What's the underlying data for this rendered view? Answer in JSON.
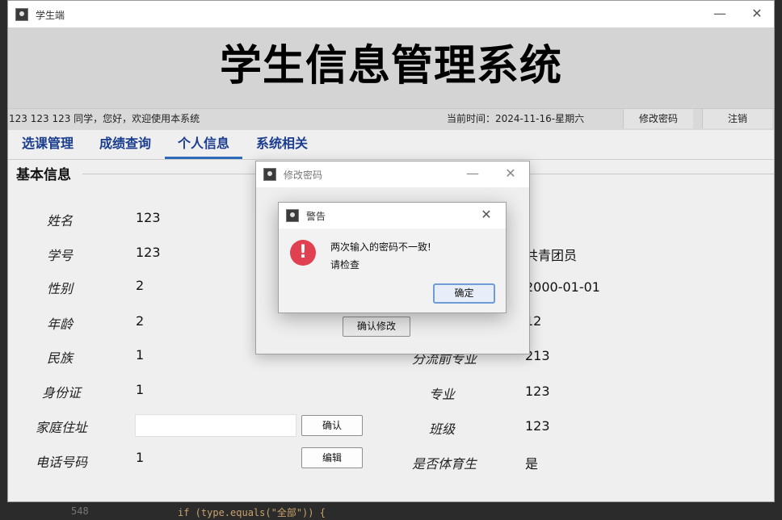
{
  "window": {
    "title": "学生端",
    "minimize_glyph": "—",
    "close_glyph": "✕"
  },
  "banner": {
    "title": "学生信息管理系统"
  },
  "status": {
    "greeting": "123 123 123 同学，您好，欢迎使用本系统",
    "time": "当前时间：2024-11-16-星期六",
    "change_password": "修改密码",
    "logout": "注销"
  },
  "tabs": [
    {
      "label": "选课管理"
    },
    {
      "label": "成绩查询"
    },
    {
      "label": "个人信息"
    },
    {
      "label": "系统相关"
    }
  ],
  "section": {
    "title": "基本信息"
  },
  "left_fields": [
    {
      "label": "姓名",
      "value": "123"
    },
    {
      "label": "学号",
      "value": "123"
    },
    {
      "label": "性别",
      "value": "2"
    },
    {
      "label": "年龄",
      "value": "2"
    },
    {
      "label": "民族",
      "value": "1"
    },
    {
      "label": "身份证",
      "value": "1"
    },
    {
      "label": "家庭住址",
      "value": ""
    },
    {
      "label": "电话号码",
      "value": "1"
    }
  ],
  "right_fields": [
    {
      "label": "",
      "value": "共青团员"
    },
    {
      "label": "",
      "value": "2000-01-01"
    },
    {
      "label": "",
      "value": "12"
    },
    {
      "label": "分流前专业",
      "value": "213"
    },
    {
      "label": "专业",
      "value": "123"
    },
    {
      "label": "班级",
      "value": "123"
    },
    {
      "label": "是否体育生",
      "value": "是"
    }
  ],
  "buttons": {
    "confirm": "确认",
    "edit": "编辑"
  },
  "dialog_change_password": {
    "title": "修改密码",
    "confirm_button": "确认修改",
    "minimize_glyph": "—",
    "close_glyph": "✕"
  },
  "dialog_warning": {
    "title": "警告",
    "line1": "两次输入的密码不一致!",
    "line2": "请检查",
    "ok_button": "确定",
    "icon_glyph": "!",
    "close_glyph": "✕"
  },
  "background_code": {
    "line_no": "548",
    "text": "if (type.equals(\"全部\")) {"
  },
  "colors": {
    "tab_text": "#1a3d8f",
    "tab_underline": "#2d6bb8",
    "error_icon": "#e04050"
  }
}
